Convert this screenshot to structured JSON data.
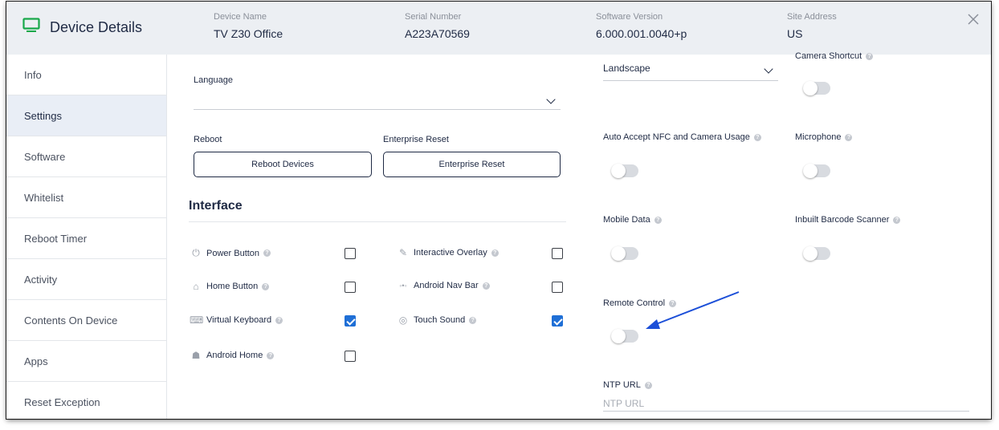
{
  "header": {
    "title": "Device Details",
    "fields": [
      {
        "label": "Device Name",
        "value": "TV Z30 Office"
      },
      {
        "label": "Serial Number",
        "value": "A223A70569"
      },
      {
        "label": "Software Version",
        "value": "6.000.001.0040+p"
      },
      {
        "label": "Site Address",
        "value": "US"
      }
    ]
  },
  "sidebar": {
    "items": [
      {
        "label": "Info"
      },
      {
        "label": "Settings",
        "active": true
      },
      {
        "label": "Software"
      },
      {
        "label": "Whitelist"
      },
      {
        "label": "Reboot Timer"
      },
      {
        "label": "Activity"
      },
      {
        "label": "Contents On Device"
      },
      {
        "label": "Apps"
      },
      {
        "label": "Reset Exception"
      }
    ]
  },
  "settings": {
    "language_label": "Language",
    "language_value": "",
    "reboot_label": "Reboot",
    "reboot_button": "Reboot Devices",
    "enterprise_label": "Enterprise Reset",
    "enterprise_button": "Enterprise Reset",
    "interface_title": "Interface",
    "interface_items": [
      {
        "label": "Power Button",
        "checked": false,
        "icon": "power-icon"
      },
      {
        "label": "Interactive Overlay",
        "checked": false,
        "icon": "overlay-icon"
      },
      {
        "label": "Home Button",
        "checked": false,
        "icon": "home-icon"
      },
      {
        "label": "Android Nav Bar",
        "checked": false,
        "icon": "nav-bar-icon"
      },
      {
        "label": "Virtual Keyboard",
        "checked": true,
        "icon": "keyboard-icon"
      },
      {
        "label": "Touch Sound",
        "checked": true,
        "icon": "sound-icon"
      },
      {
        "label": "Android Home",
        "checked": false,
        "icon": "android-icon"
      }
    ],
    "orientation_value": "Landscape",
    "toggles": [
      {
        "label": "Camera Shortcut",
        "on": false
      },
      {
        "label": "Auto Accept NFC and Camera Usage",
        "on": false
      },
      {
        "label": "Microphone",
        "on": false
      },
      {
        "label": "Mobile Data",
        "on": false
      },
      {
        "label": "Inbuilt Barcode Scanner",
        "on": false
      },
      {
        "label": "Remote Control",
        "on": false
      }
    ],
    "ntp_label": "NTP URL",
    "ntp_placeholder": "NTP URL",
    "help_glyph": "?"
  },
  "colors": {
    "accent": "#1f6fd6",
    "brand_icon": "#18a84a",
    "annotation_arrow": "#1c4fd8",
    "text_dark": "#1f2a44"
  }
}
